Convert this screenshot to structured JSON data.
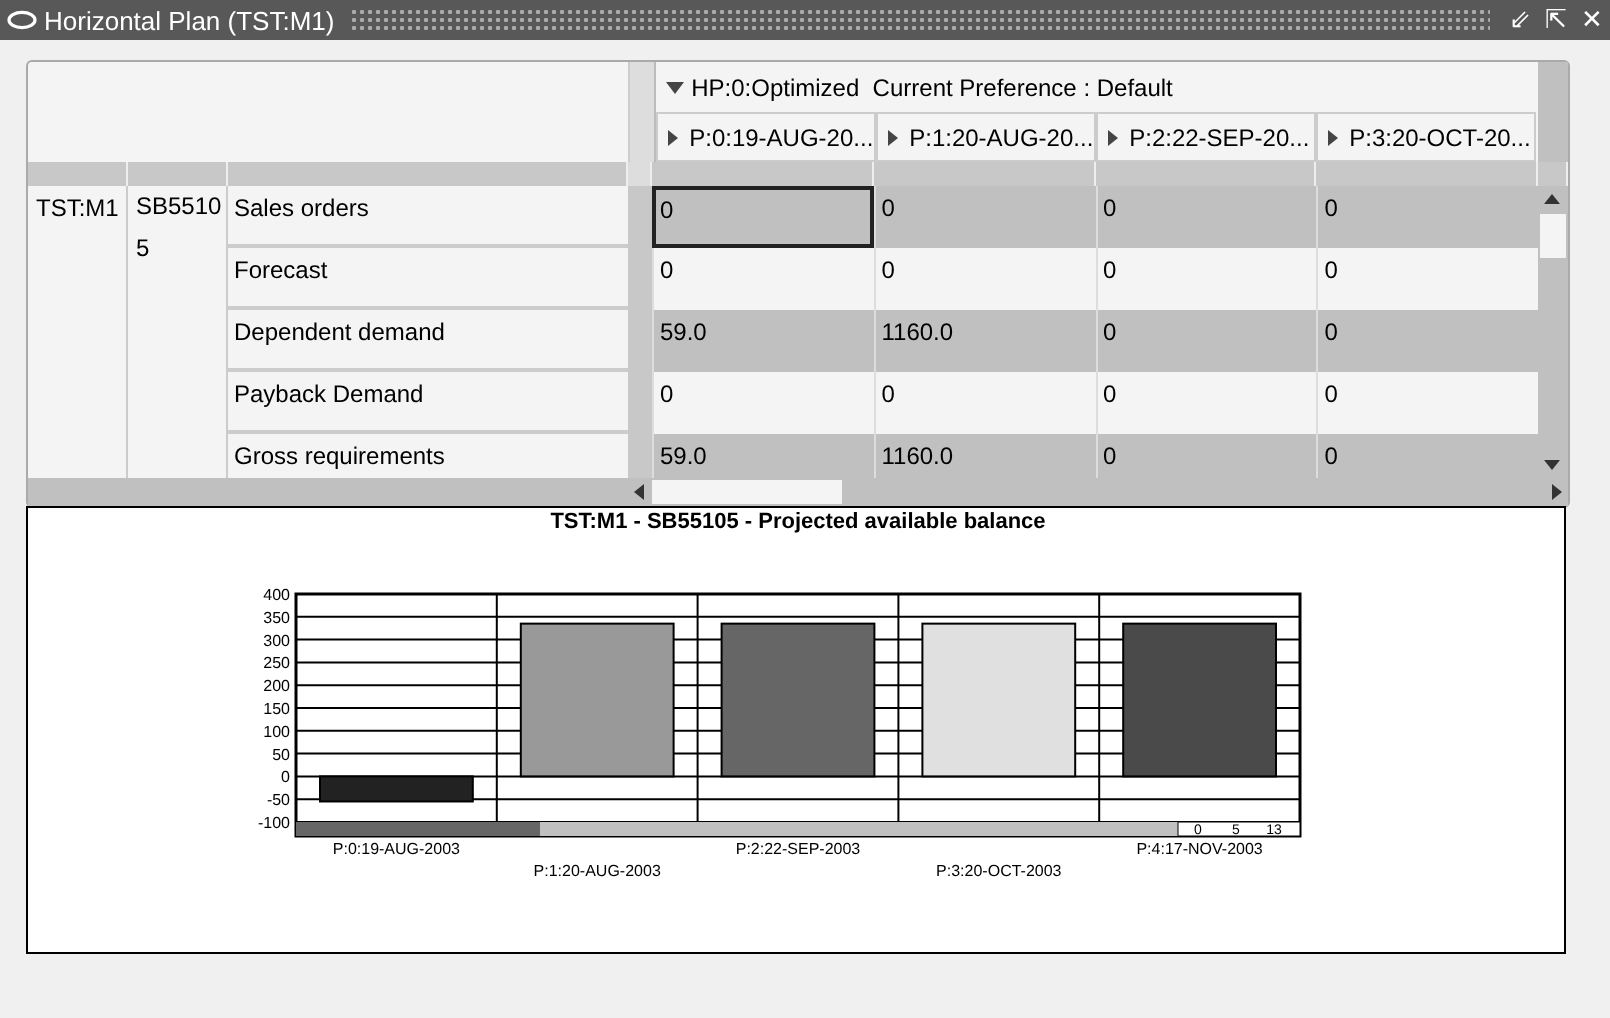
{
  "window": {
    "title": "Horizontal Plan (TST:M1)",
    "controls": [
      "⇙",
      "⇱",
      "✕"
    ]
  },
  "plan": {
    "header": "HP:0:Optimized  Current Preference : Default",
    "periods": [
      "P:0:19-AUG-20...",
      "P:1:20-AUG-20...",
      "P:2:22-SEP-20...",
      "P:3:20-OCT-20..."
    ],
    "org": "TST:M1",
    "item": "SB55105",
    "rows": [
      {
        "label": "Sales orders",
        "cells": [
          {
            "text": "0",
            "selected": true
          },
          {
            "text": "0",
            "selected": false
          },
          {
            "text": "0",
            "selected": false
          },
          {
            "text": "0",
            "selected": false
          }
        ]
      },
      {
        "label": "Forecast",
        "cells": [
          {
            "text": "0",
            "selected": false
          },
          {
            "text": "0",
            "selected": false
          },
          {
            "text": "0",
            "selected": false
          },
          {
            "text": "0",
            "selected": false
          }
        ]
      },
      {
        "label": "Dependent demand",
        "cells": [
          {
            "text": "59.0",
            "selected": false
          },
          {
            "text": "1160.0",
            "selected": false
          },
          {
            "text": "0",
            "selected": false
          },
          {
            "text": "0",
            "selected": false
          }
        ]
      },
      {
        "label": "Payback Demand",
        "cells": [
          {
            "text": "0",
            "selected": false
          },
          {
            "text": "0",
            "selected": false
          },
          {
            "text": "0",
            "selected": false
          },
          {
            "text": "0",
            "selected": false
          }
        ]
      },
      {
        "label": "Gross requirements",
        "cells": [
          {
            "text": "59.0",
            "selected": false
          },
          {
            "text": "1160.0",
            "selected": false
          },
          {
            "text": "0",
            "selected": false
          },
          {
            "text": "0",
            "selected": false
          }
        ]
      }
    ]
  },
  "chart": {
    "bars": [
      {
        "color": "#222222"
      },
      {
        "color": "#999999"
      },
      {
        "color": "#666666"
      },
      {
        "color": "#e0e0e0"
      },
      {
        "color": "#4a4a4a"
      }
    ],
    "scale_labels": [
      "0",
      "5",
      "13"
    ],
    "chart_data": {
      "type": "bar",
      "grid": true,
      "title": "TST:M1 - SB55105 - Projected available balance",
      "categories": [
        "P:0:19-AUG-2003",
        "P:1:20-AUG-2003",
        "P:2:22-SEP-2003",
        "P:3:20-OCT-2003",
        "P:4:17-NOV-2003"
      ],
      "values": [
        -55,
        335,
        335,
        335,
        335
      ],
      "ylim": [
        -100,
        400
      ],
      "yticks": [
        -100,
        -50,
        0,
        50,
        100,
        150,
        200,
        250,
        300,
        350,
        400
      ]
    }
  }
}
